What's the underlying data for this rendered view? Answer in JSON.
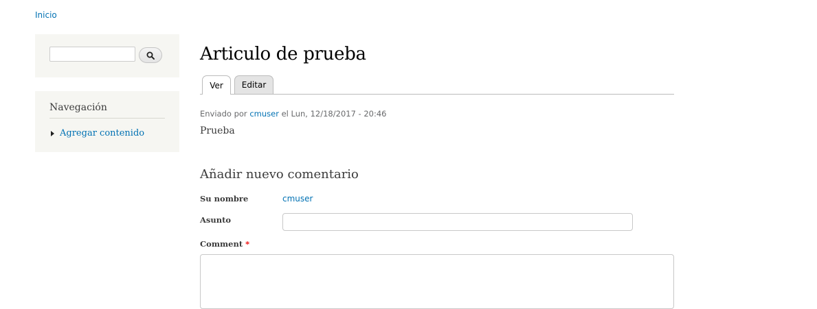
{
  "breadcrumb": {
    "home": "Inicio"
  },
  "sidebar": {
    "search": {
      "input_value": "",
      "button_icon": "search-icon"
    },
    "navigation": {
      "title": "Navegación",
      "items": [
        {
          "label": "Agregar contenido"
        }
      ]
    }
  },
  "main": {
    "title": "Articulo de prueba",
    "tabs": [
      {
        "label": "Ver",
        "active": true
      },
      {
        "label": "Editar",
        "active": false
      }
    ],
    "submitted": {
      "prefix": "Enviado por",
      "author": "cmuser",
      "date": "el Lun, 12/18/2017 - 20:46"
    },
    "body": "Prueba"
  },
  "comment_form": {
    "title": "Añadir nuevo comentario",
    "name_label": "Su nombre",
    "name_value": "cmuser",
    "subject_label": "Asunto",
    "subject_value": "",
    "comment_label": "Comment",
    "required_marker": "*",
    "comment_value": ""
  }
}
